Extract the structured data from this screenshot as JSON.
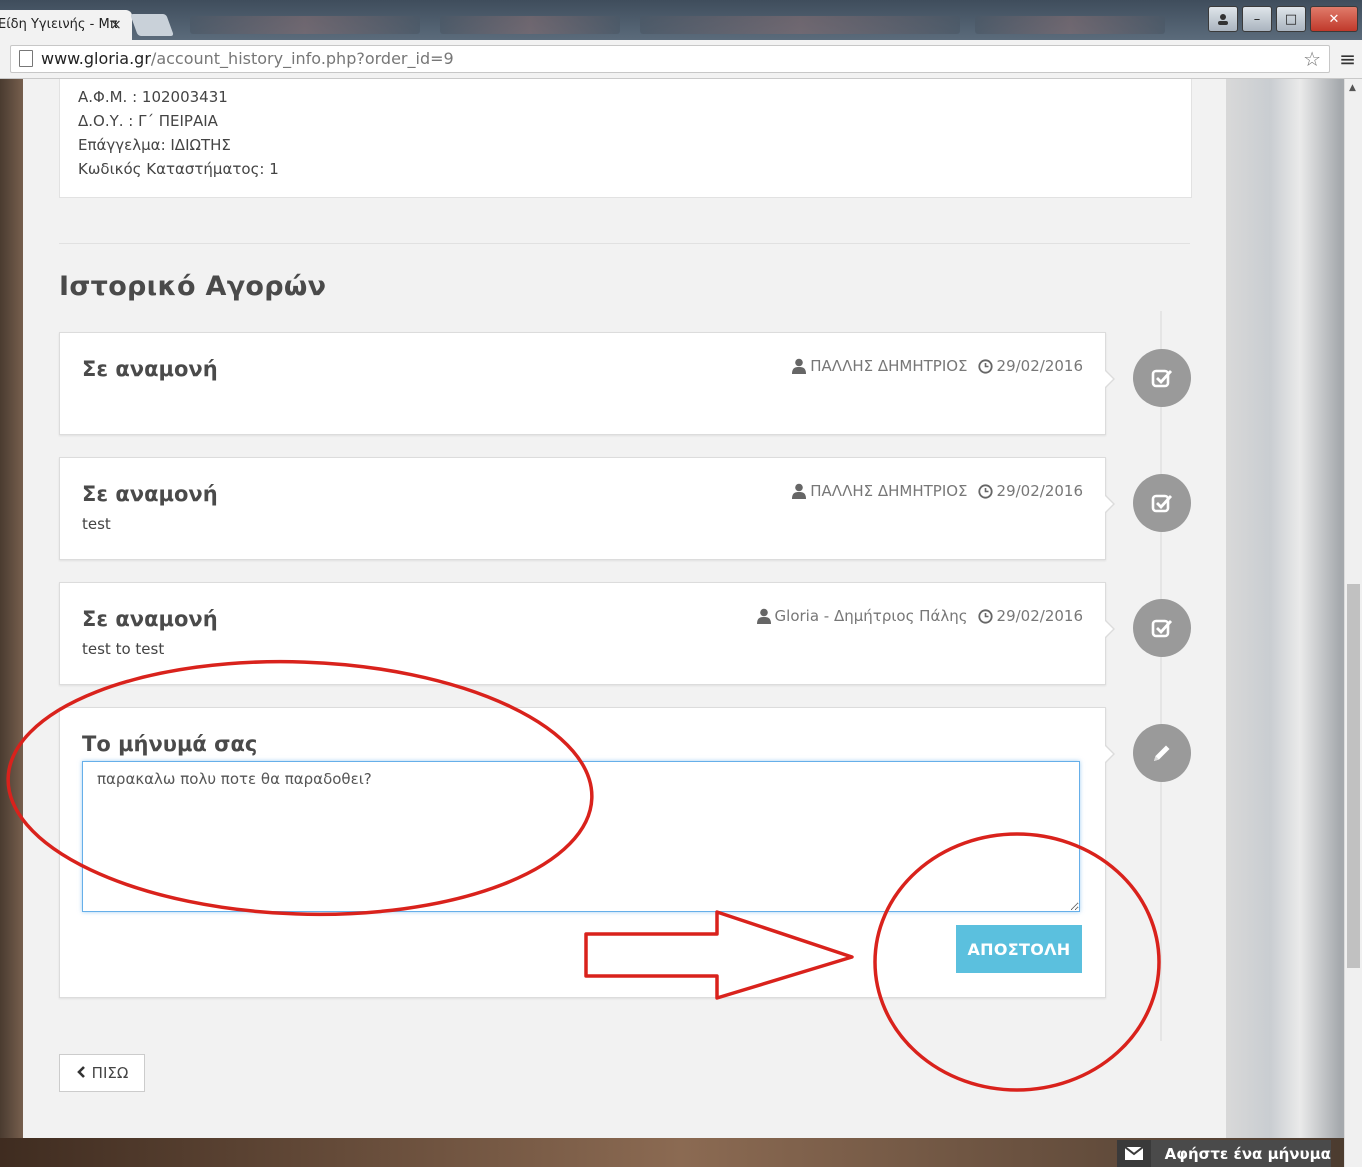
{
  "browser": {
    "tab_title": "Είδη Υγιεινής - Μπ",
    "tab_close": "×",
    "url_host": "www.gloria.gr",
    "url_path": "/account_history_info.php?order_id=9",
    "window_controls": {
      "minimize": "–",
      "maximize": "□",
      "close": "✕"
    }
  },
  "store_info": {
    "afm": "Α.Φ.Μ. : 102003431",
    "doy": "Δ.Ο.Υ. : Γ΄ ΠΕΙΡΑΙΑ",
    "profession": "Επάγγελμα: ΙΔΙΩΤΗΣ",
    "store_code": "Κωδικός Καταστήματος: 1"
  },
  "history": {
    "title": "Ιστορικό Αγορών",
    "entries": [
      {
        "status": "Σε αναμονή",
        "comment": "",
        "author": "ΠΑΛΛΗΣ ΔΗΜΗΤΡΙΟΣ",
        "date": "29/02/2016",
        "icon": "check-square-icon"
      },
      {
        "status": "Σε αναμονή",
        "comment": "test",
        "author": "ΠΑΛΛΗΣ ΔΗΜΗΤΡΙΟΣ",
        "date": "29/02/2016",
        "icon": "check-square-icon"
      },
      {
        "status": "Σε αναμονή",
        "comment": "test to test",
        "author": "Gloria - Δημήτριος Πάλης",
        "date": "29/02/2016",
        "icon": "check-square-icon"
      }
    ]
  },
  "message_form": {
    "title": "Το μήνυμά σας",
    "value": "παρακαλω πολυ ποτε θα παραδοθει?",
    "submit_label": "ΑΠΟΣΤΟΛΗ",
    "icon": "pencil-icon"
  },
  "back_button": {
    "label": "ΠΙΣΩ",
    "icon": "chevron-left-icon"
  },
  "chat_widget": {
    "label": "Αφήστε ένα μήνυμα",
    "icon": "envelope-icon"
  },
  "colors": {
    "accent": "#5bc0de",
    "annotation": "#d9221c",
    "badge": "#9a9a9a"
  }
}
